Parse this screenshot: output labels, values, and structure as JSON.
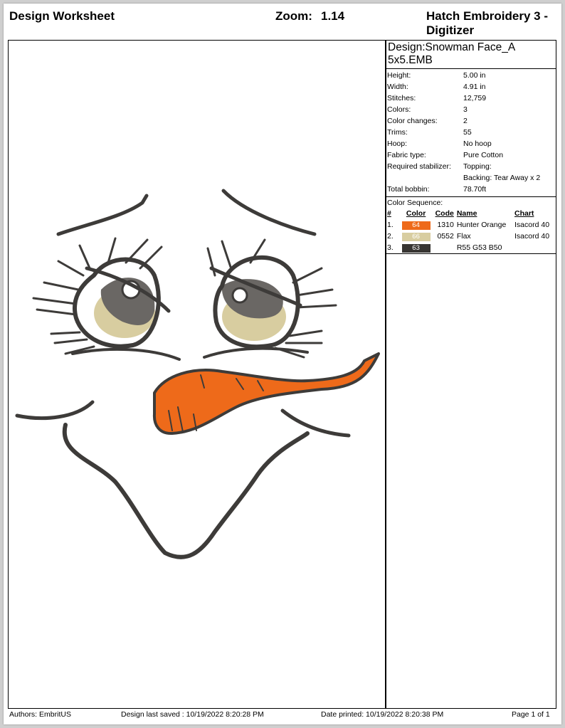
{
  "header": {
    "title": "Design Worksheet",
    "zoom_label": "Zoom:",
    "zoom_value": "1.14",
    "app_name": "Hatch Embroidery 3 - Digitizer"
  },
  "design": {
    "name": "Design:Snowman Face_A 5x5.EMB",
    "properties": [
      {
        "label": "Height:",
        "value": "5.00 in"
      },
      {
        "label": "Width:",
        "value": "4.91 in"
      },
      {
        "label": "Stitches:",
        "value": "12,759"
      },
      {
        "label": "Colors:",
        "value": "3"
      },
      {
        "label": "Color changes:",
        "value": "2"
      },
      {
        "label": "Trims:",
        "value": "55"
      },
      {
        "label": "Hoop:",
        "value": "No hoop"
      },
      {
        "label": "Fabric type:",
        "value": "Pure Cotton"
      },
      {
        "label": "Required stabilizer:",
        "value": "Topping:"
      },
      {
        "label": "",
        "value": "Backing: Tear Away x 2"
      },
      {
        "label": "Total bobbin:",
        "value": "78.70ft"
      }
    ]
  },
  "color_sequence": {
    "heading": "Color Sequence:",
    "columns": {
      "num": "#",
      "color": "Color",
      "code": "Code",
      "name": "Name",
      "chart": "Chart"
    },
    "rows": [
      {
        "num": "1.",
        "swatch_label": "64",
        "swatch_color": "#ee6a1a",
        "swatch_text_color": "#ffffff",
        "code": "1310",
        "name": "Hunter Orange",
        "chart": "Isacord 40"
      },
      {
        "num": "2.",
        "swatch_label": "66",
        "swatch_color": "#d8cda0",
        "swatch_text_color": "#ffffff",
        "code": "0552",
        "name": "Flax",
        "chart": "Isacord 40"
      },
      {
        "num": "3.",
        "swatch_label": "63",
        "swatch_color": "#373532",
        "swatch_text_color": "#ffffff",
        "code": "",
        "name": "R55 G53 B50",
        "chart": ""
      }
    ]
  },
  "colors": {
    "outline": "#3d3b39",
    "orange": "#ee6a1a",
    "flax": "#d8cda0"
  },
  "footer": {
    "authors": "Authors: EmbritUS",
    "saved": "Design last saved : 10/19/2022 8:20:28 PM",
    "printed": "Date printed: 10/19/2022 8:20:38 PM",
    "page": "Page 1 of 1"
  }
}
